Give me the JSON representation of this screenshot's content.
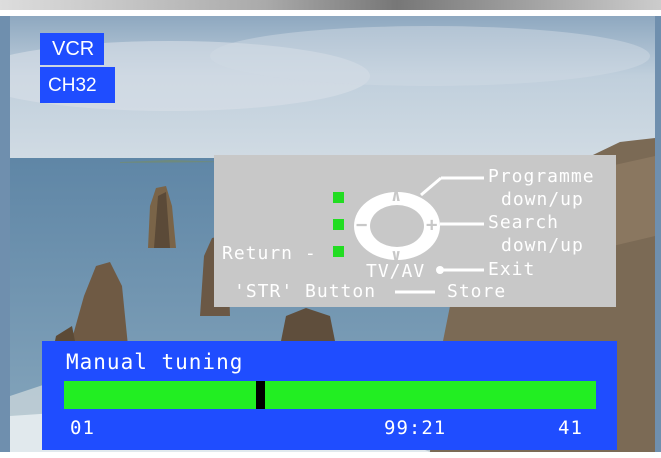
{
  "badges": {
    "mode": "VCR",
    "channel": "CH32"
  },
  "help_panel": {
    "programme": "Programme",
    "programme_dir": "down/up",
    "search": "Search",
    "search_dir": "down/up",
    "return": "Return -",
    "tv_av": "TV/AV",
    "exit": "Exit",
    "str_button": "'STR' Button",
    "store": "Store",
    "up_symbol": "∧",
    "down_symbol": "∨",
    "minus_symbol": "−",
    "plus_symbol": "+",
    "led_color": "#22dd22"
  },
  "tuning": {
    "title": "Manual tuning",
    "left_value": "01",
    "frequency": "99:21",
    "right_value": "41",
    "level": 0.37,
    "bar_color": "#22ee22",
    "panel_color": "#1f4dff"
  }
}
